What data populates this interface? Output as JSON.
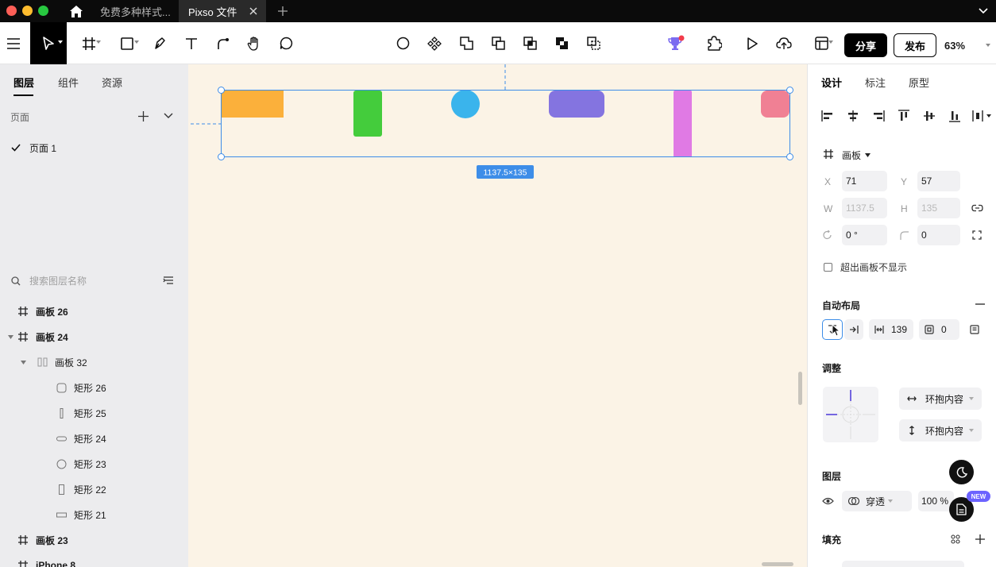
{
  "titlebar": {
    "tabs": [
      {
        "label": "免费多种样式..."
      },
      {
        "label": "Pixso 文件"
      }
    ]
  },
  "toolbar": {
    "share_label": "分享",
    "publish_label": "发布",
    "zoom": "63%"
  },
  "left_panel": {
    "tabs": [
      "图层",
      "组件",
      "资源"
    ],
    "pages_title": "页面",
    "pages": [
      "页面 1"
    ],
    "search_placeholder": "搜索图层名称",
    "layers": [
      {
        "name": "画板 26"
      },
      {
        "name": "画板 24"
      },
      {
        "name": "画板 32"
      },
      {
        "name": "矩形 26"
      },
      {
        "name": "矩形 25"
      },
      {
        "name": "矩形 24"
      },
      {
        "name": "矩形 23"
      },
      {
        "name": "矩形 22"
      },
      {
        "name": "矩形 21"
      },
      {
        "name": "画板 23"
      },
      {
        "name": "iPhone 8"
      }
    ]
  },
  "canvas": {
    "size_badge": "1137.5×135",
    "colors": {
      "background": "#fbf3e6",
      "selection": "#3d8de8",
      "rect_orange": "#fbb03b",
      "rect_green": "#44cc3c",
      "circle_blue": "#3ab4ec",
      "pill_purple": "#8474e0",
      "bar_pink": "#e07ae4",
      "rounded_rose": "#f08094"
    }
  },
  "right_panel": {
    "tabs": [
      "设计",
      "标注",
      "原型"
    ],
    "frame_label": "画板",
    "fields": {
      "x_label": "X",
      "x": "71",
      "y_label": "Y",
      "y": "57",
      "w_label": "W",
      "w": "1137.5",
      "h_label": "H",
      "h": "135",
      "rotation": "0 °",
      "radius": "0"
    },
    "clip_label": "超出画板不显示",
    "auto_layout_title": "自动布局",
    "spacing": "139",
    "padding": "0",
    "adjust_title": "调整",
    "horizontal_sizing": "环抱内容",
    "vertical_sizing": "环抱内容",
    "layer_title": "图层",
    "blend_mode": "穿透",
    "opacity": "100 %",
    "new_badge": "NEW",
    "fill_title": "填充"
  }
}
